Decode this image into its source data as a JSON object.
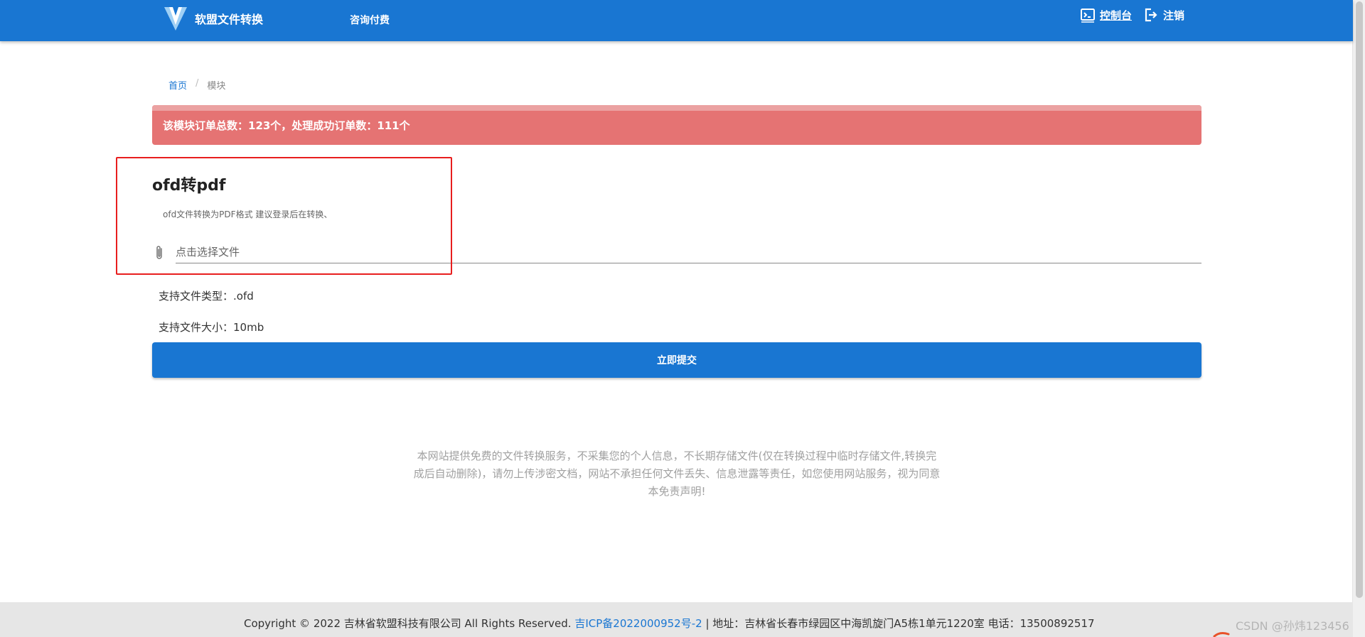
{
  "header": {
    "brand_name": "软盟文件转换",
    "nav_consult": "咨询付费",
    "console_label": "控制台",
    "logout_label": "注销"
  },
  "breadcrumb": {
    "home": "首页",
    "separator": "/",
    "current": "模块"
  },
  "alert": {
    "text": "该模块订单总数：123个，处理成功订单数：111个"
  },
  "module": {
    "title": "ofd转pdf",
    "description": "ofd文件转换为PDF格式 建议登录后在转换、",
    "file_placeholder": "点击选择文件",
    "file_types": "支持文件类型：.ofd",
    "file_size": "支持文件大小：10mb",
    "submit_label": "立即提交"
  },
  "disclaimer": "本网站提供免费的文件转换服务，不采集您的个人信息，不长期存储文件(仅在转换过程中临时存储文件,转换完成后自动删除)，请勿上传涉密文档，网站不承担任何文件丢失、信息泄露等责任，如您使用网站服务，视为同意本免责声明!",
  "footer": {
    "copyright": "Copyright © 2022 吉林省软盟科技有限公司 All Rights Reserved. ",
    "icp": "吉ICP备2022000952号-2",
    "divider": " | ",
    "address": " 地址：吉林省长春市绿园区中海凯旋门A5栋1单元1220室  电话：13500892517"
  },
  "watermark": "CSDN @孙炜123456",
  "colors": {
    "primary": "#1976d2",
    "alert": "#e57373",
    "annotation": "#e81e1e"
  },
  "icons": [
    "logo-v-icon",
    "console-icon",
    "logout-icon",
    "paperclip-icon"
  ]
}
